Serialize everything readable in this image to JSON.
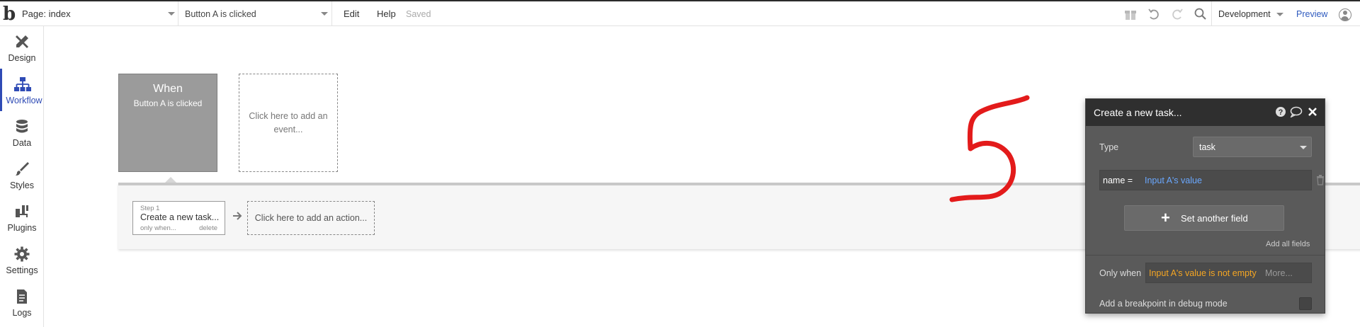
{
  "topbar": {
    "page_select": "Page: index",
    "event_select": "Button A is clicked",
    "menu": {
      "edit": "Edit",
      "help": "Help"
    },
    "status": "Saved",
    "icons": [
      "gift-icon",
      "undo-icon",
      "redo-icon",
      "search-icon"
    ],
    "env_select": "Development",
    "preview": "Preview"
  },
  "sidebar": {
    "items": [
      {
        "label": "Design",
        "icon": "design-icon"
      },
      {
        "label": "Workflow",
        "icon": "workflow-icon",
        "active": true
      },
      {
        "label": "Data",
        "icon": "database-icon"
      },
      {
        "label": "Styles",
        "icon": "brush-icon"
      },
      {
        "label": "Plugins",
        "icon": "plug-icon"
      },
      {
        "label": "Settings",
        "icon": "gear-icon"
      },
      {
        "label": "Logs",
        "icon": "document-icon"
      }
    ]
  },
  "event": {
    "when": "When",
    "trigger": "Button A is clicked",
    "add_event": "Click here to add an event..."
  },
  "steps": {
    "step1": {
      "number": "Step 1",
      "name": "Create a new task...",
      "only_when": "only when...",
      "delete": "delete"
    },
    "add_action": "Click here to add an action..."
  },
  "annotation": {
    "text": "5",
    "color": "#e31b1b"
  },
  "editor": {
    "title": "Create a new task...",
    "type_label": "Type",
    "type_value": "task",
    "field_name": "name =",
    "field_value": "Input A's value",
    "set_another": "Set another field",
    "add_all": "Add all fields",
    "only_when_label": "Only when",
    "only_when_value": "Input A's value is not empty",
    "only_when_more": "More...",
    "breakpoint": "Add a breakpoint in debug mode"
  },
  "colors": {
    "accent": "#2f4bb5",
    "dynamic_value": "#6aa8ff",
    "condition": "#f5a623",
    "editor_bg": "#5a5a5a",
    "editor_header": "#2f2f2f"
  }
}
